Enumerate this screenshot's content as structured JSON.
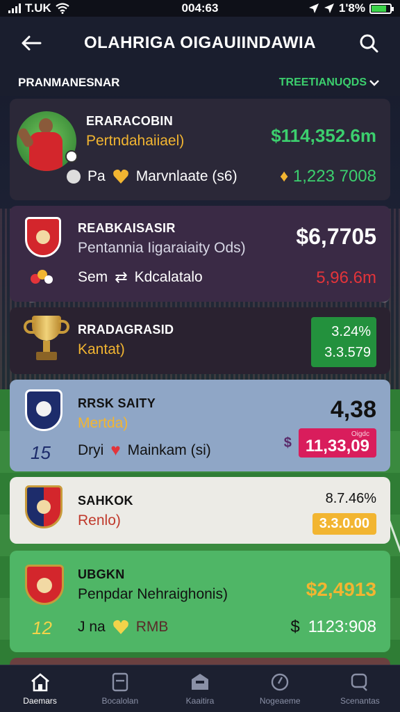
{
  "status": {
    "carrier": "T.UK",
    "time": "004:63",
    "battery": "1'8%"
  },
  "header": {
    "title": "OLAHRIGA OIGAUIINDAWIA"
  },
  "section": {
    "title": "PRANMANESNAR",
    "filter": "TREETIANUQDS"
  },
  "cards": [
    {
      "name": "ERARACOBIN",
      "sub": "Pertndahaiiael)",
      "meta_a": "Pa",
      "meta_b": "Marvnlaate (s6)",
      "value": "$114,352.6m",
      "change": "1,223 7008",
      "colors": {
        "bg": "#2b2838",
        "sub": "#f2b531",
        "value": "#3ccf6e",
        "change": "#f2b531"
      }
    },
    {
      "name": "REABKAISASIR",
      "sub": "Pentannia Iigaraiaity Ods)",
      "meta_a": "Sem",
      "meta_b": "Kdcalatalo",
      "value": "$6,7705",
      "change": "5,96.6m",
      "colors": {
        "bg": "#3a2a45",
        "sub": "#d8d8e6",
        "value": "#ffffff",
        "change": "#e3343a"
      }
    },
    {
      "name": "RRADAGRASID",
      "sub": "Kantat)",
      "value": "3.24%",
      "change": "3.3.579",
      "colors": {
        "bg": "#2a2230",
        "sub": "#f2b531",
        "badge": "#23913d"
      }
    },
    {
      "name": "RRSK SAITY",
      "sub": "Mertda)",
      "meta_a": "Dryi",
      "meta_b": "Mainkam (si)",
      "number": "15",
      "value": "4,38",
      "badge_top": "Oigdc",
      "change": "11,33,09",
      "colors": {
        "bg": "#8fa6c6",
        "sub": "#f2b531",
        "value": "#111111",
        "badge": "#d91d5c"
      }
    },
    {
      "name": "SAHKOK",
      "sub": "Renlo)",
      "value": "8.7.46%",
      "change": "3.3.0.00",
      "colors": {
        "bg": "#ecebe6",
        "sub": "#c0392b",
        "value": "#111111",
        "badge": "#f2b531"
      }
    },
    {
      "name": "UBGKN",
      "sub": "Penpdar Nehraighonis)",
      "meta_a": "J na",
      "meta_b": "RMB",
      "number": "12",
      "value": "$2,4913",
      "change": "1123:908",
      "colors": {
        "bg": "#4fb666",
        "sub": "#111111",
        "value": "#f2b531",
        "change": "#ffffff"
      }
    }
  ],
  "nav": [
    {
      "label": "Daemars",
      "icon": "home-icon",
      "active": true
    },
    {
      "label": "Bocalolan",
      "icon": "book-icon",
      "active": false
    },
    {
      "label": "Kaaitira",
      "icon": "archive-icon",
      "active": false
    },
    {
      "label": "Nogeaeme",
      "icon": "compass-icon",
      "active": false
    },
    {
      "label": "Scenantas",
      "icon": "chat-icon",
      "active": false
    }
  ]
}
